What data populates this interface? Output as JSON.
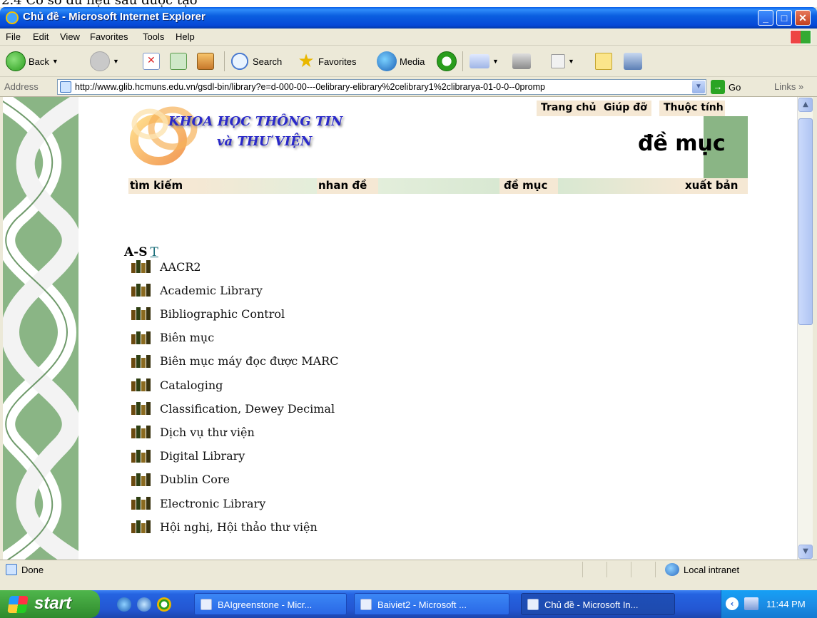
{
  "caption_fragment": "2.4 Cơ sở dữ liệu sau được tạo",
  "window": {
    "title": "Chủ đề - Microsoft Internet Explorer",
    "buttons": [
      "minimize",
      "maximize",
      "close"
    ]
  },
  "menu": [
    "File",
    "Edit",
    "View",
    "Favorites",
    "Tools",
    "Help"
  ],
  "toolbar": {
    "back_label": "Back",
    "search_label": "Search",
    "favorites_label": "Favorites",
    "media_label": "Media"
  },
  "address": {
    "label": "Address",
    "url": "http://www.glib.hcmuns.edu.vn/gsdl-bin/library?e=d-000-00---0elibrary-elibrary%2celibrary1%2clibrarya-01-0-0--0promp",
    "go_label": "Go",
    "links_label": "Links"
  },
  "page": {
    "top_nav": [
      "Trang chủ",
      "Giúp đỡ",
      "Thuộc tính"
    ],
    "logo_line1": "KHOA HỌC THÔNG TIN",
    "logo_line2": "và THƯ VIỆN",
    "heading": "đề mục",
    "tabs": [
      "tìm kiếm",
      "nhan đề",
      "đề mục",
      "xuất bản"
    ],
    "alpha_current": "A-S",
    "alpha_link": "T",
    "subjects": [
      "AACR2",
      "Academic Library",
      "Bibliographic Control",
      "Biên mục",
      "Biên mục máy đọc được MARC",
      "Cataloging",
      "Classification, Dewey Decimal",
      "Dịch vụ thư viện",
      "Digital Library",
      "Dublin Core",
      "Electronic Library",
      "Hội nghị, Hội thảo thư viện"
    ]
  },
  "status": {
    "text": "Done",
    "zone": "Local intranet"
  },
  "taskbar": {
    "start_label": "start",
    "tasks": [
      "BAIgreenstone - Micr...",
      "Baiviet2 - Microsoft ...",
      "Chủ đề - Microsoft In..."
    ],
    "active_task": 2,
    "clock": "11:44 PM"
  },
  "colors": {
    "content_green": "#8ab585",
    "tab_beige": "#f5e8d4",
    "logo_blue": "#2a29c9",
    "link_teal": "#1a6e7a"
  }
}
